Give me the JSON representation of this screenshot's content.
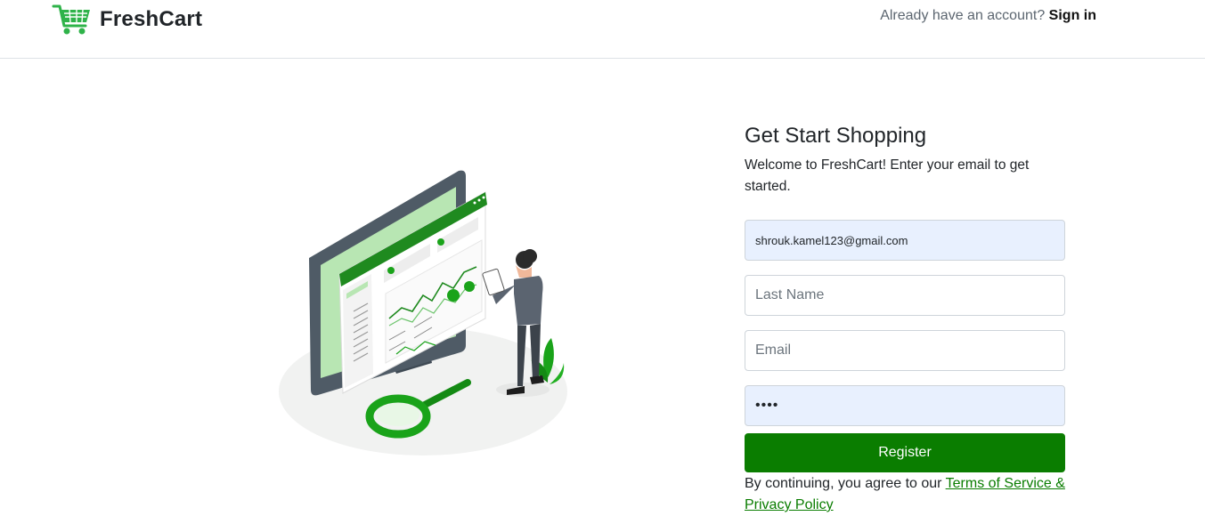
{
  "header": {
    "brand_name": "FreshCart",
    "brand_icon": "shopping-cart-icon",
    "account_prompt": "Already have an account?",
    "signin_label": "Sign in"
  },
  "illustration": {
    "icon": "analytics-dashboard-illustration"
  },
  "form": {
    "title": "Get Start Shopping",
    "subtitle": "Welcome to FreshCart! Enter your email to get started.",
    "fields": [
      {
        "value": "shrouk.kamel123@gmail.com",
        "placeholder": ""
      },
      {
        "value": "",
        "placeholder": "Last Name"
      },
      {
        "value": "",
        "placeholder": "Email"
      },
      {
        "value": "••••",
        "placeholder": ""
      }
    ],
    "register_label": "Register",
    "terms_prefix": "By continuing, you agree to our ",
    "terms_link": "Terms of Service & Privacy Policy"
  },
  "colors": {
    "brand_green": "#0a7d00",
    "autofill_bg": "#e8f0fe",
    "illustration_green": "#1aa31a",
    "monitor_dark": "#4f5b66"
  }
}
